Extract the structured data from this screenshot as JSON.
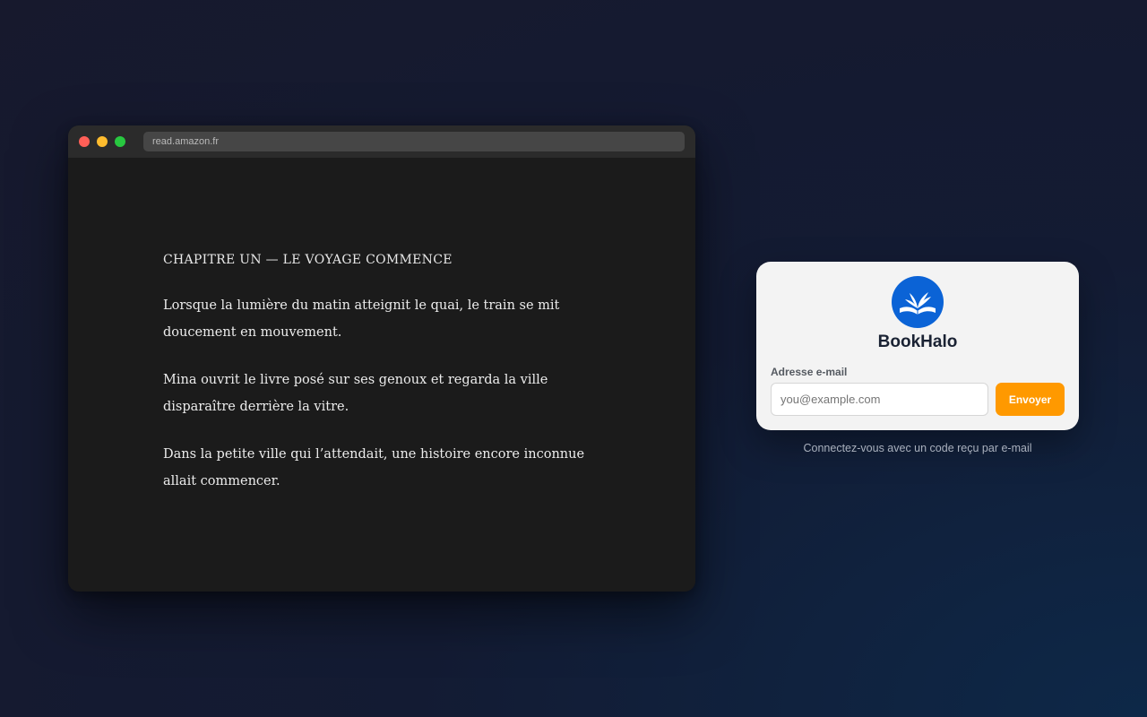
{
  "browser": {
    "url": "read.amazon.fr"
  },
  "reader": {
    "chapter_title": "CHAPITRE UN — LE VOYAGE COMMENCE",
    "paragraphs": [
      "Lorsque la lumière du matin atteignit le quai, le train se mit doucement en mouvement.",
      "Mina ouvrit le livre posé sur ses genoux et regarda la ville disparaître derrière la vitre.",
      "Dans la petite ville qui l’attendait, une histoire encore inconnue allait commencer."
    ]
  },
  "login": {
    "logo_icon": "open-book-icon",
    "brand": "BookHalo",
    "email_label": "Adresse e-mail",
    "email_placeholder": "you@example.com",
    "email_value": "",
    "send_label": "Envoyer",
    "hint": "Connectez-vous avec un code reçu par e-mail"
  },
  "colors": {
    "accent": "#ff9900",
    "brand_blue": "#0b63d6",
    "close": "#ff5f57",
    "minimize": "#febc2e",
    "maximize": "#28c840"
  }
}
